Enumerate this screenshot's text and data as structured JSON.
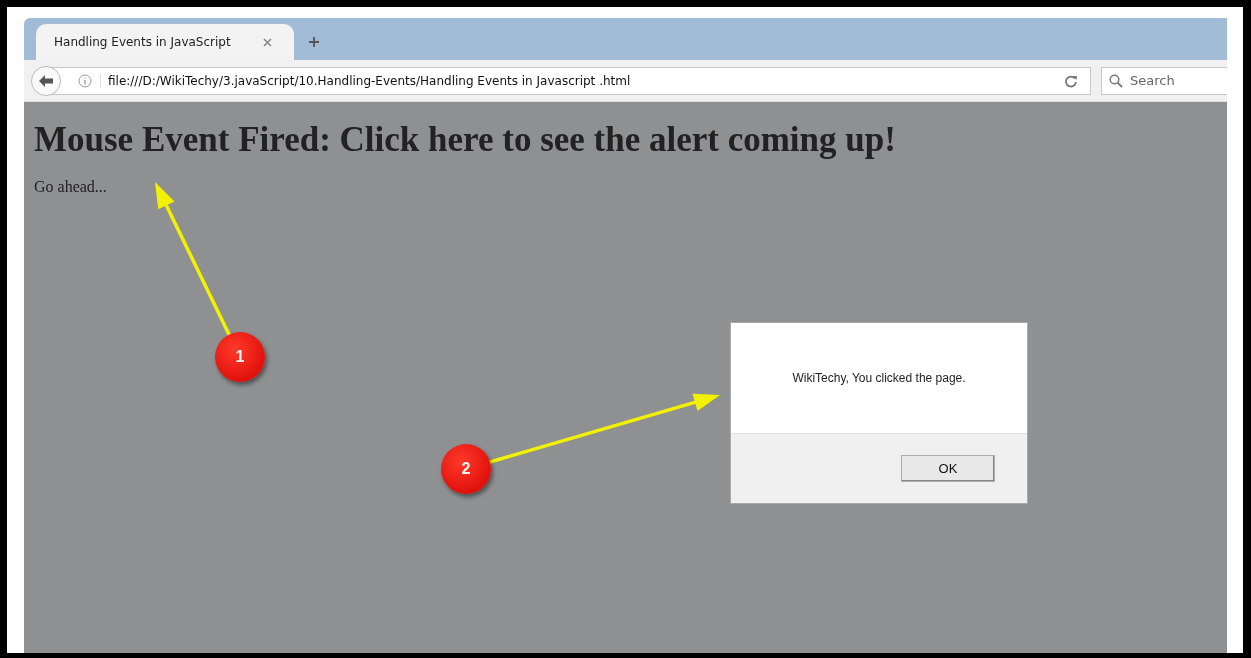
{
  "tabs": [
    {
      "label": "Handling Events in JavaScript",
      "selected": true
    }
  ],
  "address_bar": {
    "url": "file:///D:/WikiTechy/3.javaScript/10.Handling-Events/Handling Events in Javascript .html"
  },
  "search": {
    "placeholder": "Search"
  },
  "page": {
    "heading": "Mouse Event Fired: Click here to see the alert coming up!",
    "text": "Go ahead..."
  },
  "dialog": {
    "message": "WikiTechy, You clicked the page.",
    "buttons": [
      "OK"
    ]
  },
  "annotations": [
    {
      "label": "1"
    },
    {
      "label": "2"
    }
  ]
}
